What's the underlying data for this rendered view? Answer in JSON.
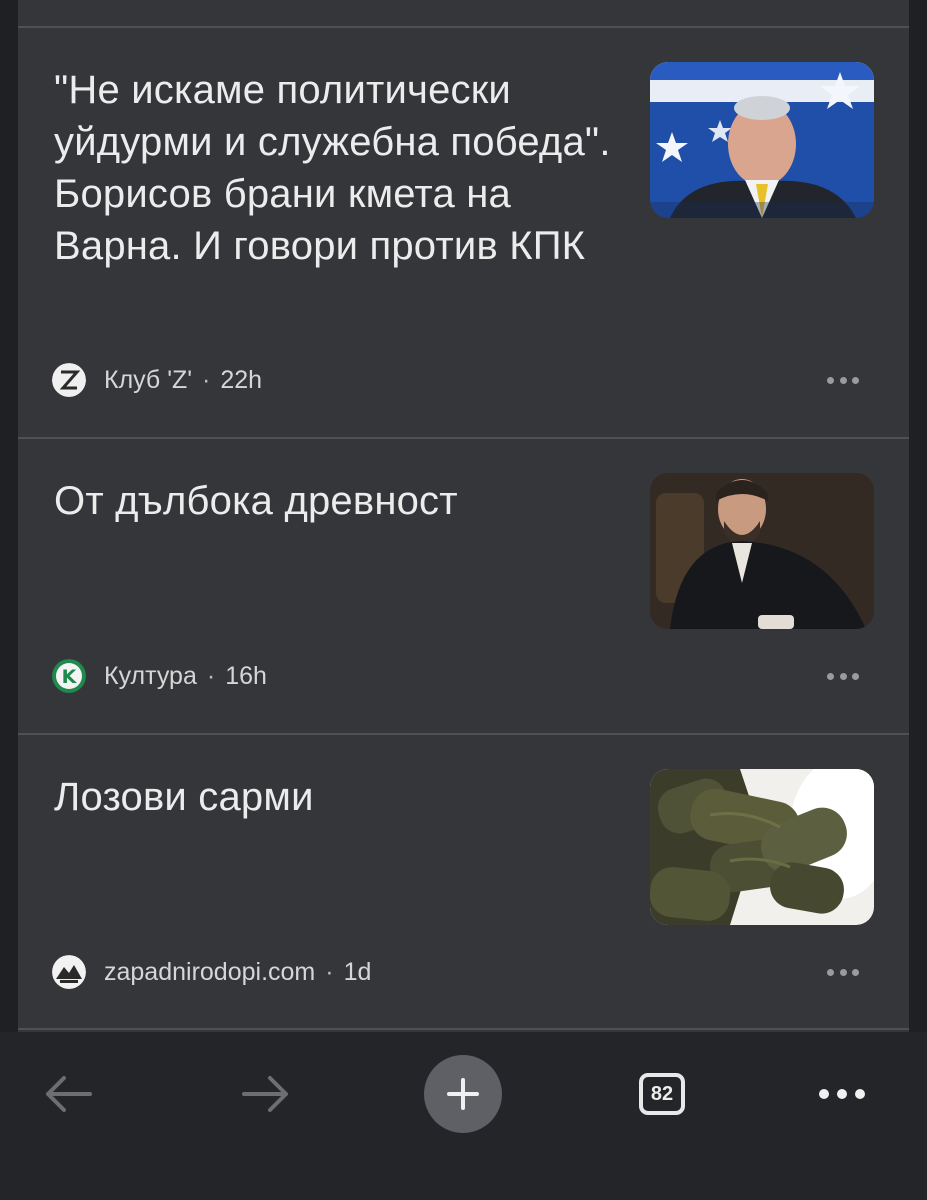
{
  "feed": {
    "cards": [
      {
        "headline": "\"Не искаме политически уйдурми и служебна победа\". Борисов брани кмета на Варна. И говори против КПК",
        "source": "Клуб 'Z'",
        "age": "22h",
        "source_icon": "club-z-logo",
        "thumbnail": "politician-at-podium-photo"
      },
      {
        "headline": "От дълбока древност",
        "source": "Култура",
        "age": "16h",
        "source_icon": "kultura-k-logo",
        "thumbnail": "historical-portrait-painting"
      },
      {
        "headline": "Лозови сарми",
        "source": "zapadnirodopi.com",
        "age": "1d",
        "source_icon": "mountain-logo",
        "thumbnail": "stuffed-vine-leaves-photo"
      }
    ],
    "separator": "·",
    "more_icon": "more-horizontal-icon"
  },
  "toolbar": {
    "back_icon": "arrow-left-icon",
    "forward_icon": "arrow-right-icon",
    "new_tab_icon": "plus-icon",
    "tab_count": "82",
    "menu_icon": "more-horizontal-icon"
  },
  "colors": {
    "feed_background": "#35363a",
    "page_background": "#1f2023",
    "text": "#ececec",
    "divider": "#4e5054"
  }
}
